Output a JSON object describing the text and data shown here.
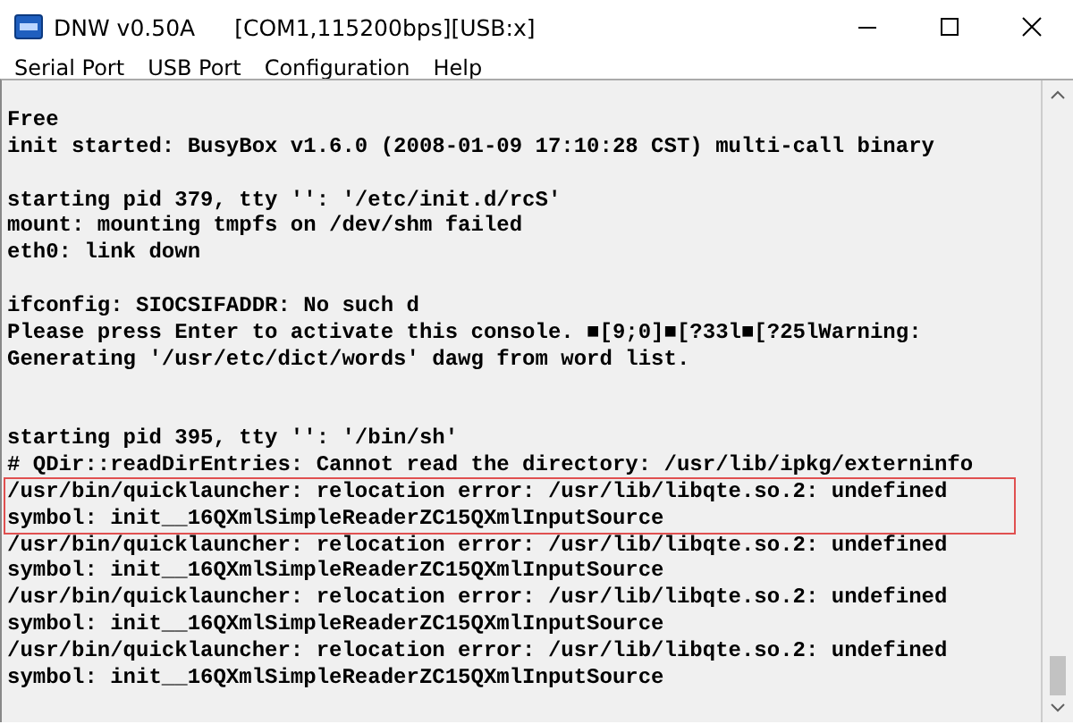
{
  "window": {
    "title": "DNW v0.50A",
    "connection": "[COM1,115200bps][USB:x]"
  },
  "menu": [
    "Serial Port",
    "USB Port",
    "Configuration",
    "Help"
  ],
  "terminal": {
    "lines": [
      {
        "kind": "text",
        "text": "Free",
        "highlighted": false
      },
      {
        "kind": "text",
        "text": "init started: BusyBox v1.6.0 (2008-01-09 17:10:28 CST) multi-call binary",
        "highlighted": false
      },
      {
        "kind": "blank"
      },
      {
        "kind": "text",
        "text": "starting pid 379, tty '': '/etc/init.d/rcS'",
        "highlighted": false
      },
      {
        "kind": "text",
        "text": "mount: mounting tmpfs on /dev/shm failed",
        "highlighted": false
      },
      {
        "kind": "text",
        "text": "eth0: link down",
        "highlighted": false
      },
      {
        "kind": "blank"
      },
      {
        "kind": "text",
        "text": "ifconfig: SIOCSIFADDR: No such d",
        "highlighted": false
      },
      {
        "kind": "text",
        "text": "Please press Enter to activate this console. ■[9;0]■[?33l■[?25lWarning:",
        "highlighted": false
      },
      {
        "kind": "text",
        "text": "Generating '/usr/etc/dict/words' dawg from word list.",
        "highlighted": false
      },
      {
        "kind": "blank"
      },
      {
        "kind": "blank"
      },
      {
        "kind": "text",
        "text": "starting pid 395, tty '': '/bin/sh'",
        "highlighted": false
      },
      {
        "kind": "text",
        "text": "# QDir::readDirEntries: Cannot read the directory: /usr/lib/ipkg/externinfo",
        "highlighted": false
      },
      {
        "kind": "text",
        "text": "/usr/bin/quicklauncher: relocation error: /usr/lib/libqte.so.2: undefined",
        "highlighted": true
      },
      {
        "kind": "text",
        "text": "symbol: init__16QXmlSimpleReaderZC15QXmlInputSource",
        "highlighted": true
      },
      {
        "kind": "text",
        "text": "/usr/bin/quicklauncher: relocation error: /usr/lib/libqte.so.2: undefined",
        "highlighted": false
      },
      {
        "kind": "text",
        "text": "symbol: init__16QXmlSimpleReaderZC15QXmlInputSource",
        "highlighted": false
      },
      {
        "kind": "text",
        "text": "/usr/bin/quicklauncher: relocation error: /usr/lib/libqte.so.2: undefined",
        "highlighted": false
      },
      {
        "kind": "text",
        "text": "symbol: init__16QXmlSimpleReaderZC15QXmlInputSource",
        "highlighted": false
      },
      {
        "kind": "text",
        "text": "/usr/bin/quicklauncher: relocation error: /usr/lib/libqte.so.2: undefined",
        "highlighted": false
      },
      {
        "kind": "text",
        "text": "symbol: init__16QXmlSimpleReaderZC15QXmlInputSource",
        "highlighted": false
      }
    ]
  }
}
